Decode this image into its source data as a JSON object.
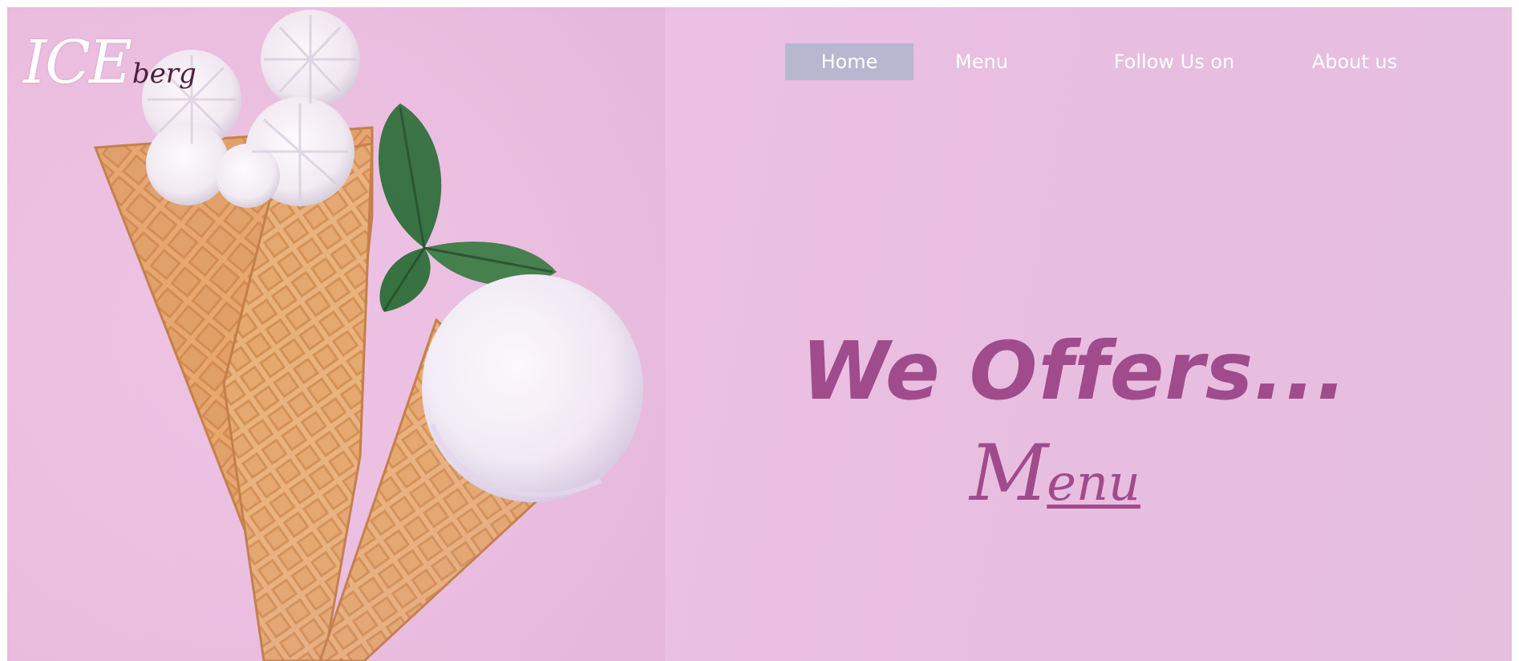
{
  "brand": {
    "logo_main": "ICE",
    "logo_sub": "berg"
  },
  "nav": {
    "items": [
      {
        "label": "Home",
        "active": true
      },
      {
        "label": "Menu",
        "active": false
      },
      {
        "label": "Follow Us on",
        "active": false
      },
      {
        "label": "About us",
        "active": false
      }
    ]
  },
  "hero": {
    "headline": "We Offers...",
    "cta_first": "M",
    "cta_rest": "enu",
    "image_alt": "ice-cream-cones-photo"
  },
  "colors": {
    "background": "#eec2e2",
    "accent_text": "#a04b8c",
    "nav_active_bg": "#b7b7cf",
    "nav_text": "#ffffff"
  }
}
